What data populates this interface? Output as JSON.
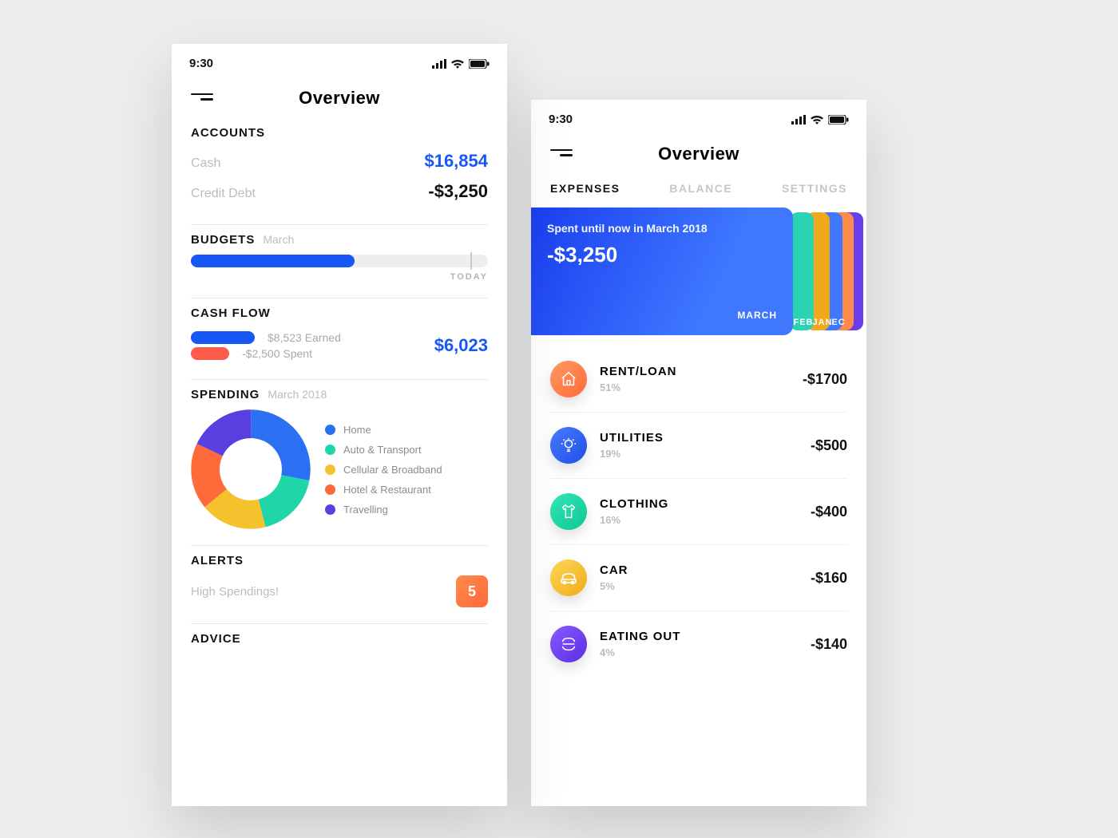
{
  "status": {
    "time": "9:30"
  },
  "header": {
    "title": "Overview"
  },
  "left": {
    "accounts": {
      "title": "ACCOUNTS",
      "rows": [
        {
          "label": "Cash",
          "value": "$16,854",
          "color": "blue"
        },
        {
          "label": "Credit Debt",
          "value": "-$3,250",
          "color": "dark"
        }
      ]
    },
    "budgets": {
      "title": "BUDGETS",
      "month": "March",
      "today_label": "TODAY",
      "fill_pct": 55,
      "today_pct": 94
    },
    "cashflow": {
      "title": "CASH FLOW",
      "earned": "$8,523 Earned",
      "spent": "-$2,500 Spent",
      "net": "$6,023"
    },
    "spending": {
      "title": "SPENDING",
      "month": "March 2018"
    },
    "alerts": {
      "title": "ALERTS",
      "text": "High Spendings!",
      "count": "5"
    },
    "advice": {
      "title": "ADVICE"
    }
  },
  "right": {
    "tabs": {
      "expenses": "EXPENSES",
      "balance": "BALANCE",
      "settings": "SETTINGS"
    },
    "card": {
      "subtitle": "Spent until now in March 2018",
      "amount": "-$3,250",
      "month_main": "MARCH",
      "months": {
        "feb": "FEB",
        "jan": "JAN",
        "dec": "EC"
      }
    },
    "expenses": [
      {
        "name": "RENT/LOAN",
        "pct": "51%",
        "amount": "-$1700",
        "color": "#ff7a4a",
        "icon": "home"
      },
      {
        "name": "UTILITIES",
        "pct": "19%",
        "amount": "-$500",
        "color": "#2f62f2",
        "icon": "bulb"
      },
      {
        "name": "CLOTHING",
        "pct": "16%",
        "amount": "-$400",
        "color": "#1ed6a8",
        "icon": "shirt"
      },
      {
        "name": "CAR",
        "pct": "5%",
        "amount": "-$160",
        "color": "#f4c62e",
        "icon": "car"
      },
      {
        "name": "EATING OUT",
        "pct": "4%",
        "amount": "-$140",
        "color": "#6a3eea",
        "icon": "food"
      }
    ]
  },
  "chart_data": {
    "type": "pie",
    "title": "Spending March 2018",
    "categories": [
      "Home",
      "Auto & Transport",
      "Cellular & Broadband",
      "Hotel & Restaurant",
      "Travelling"
    ],
    "values": [
      28,
      18,
      18,
      18,
      18
    ],
    "colors": [
      "#2b6ff2",
      "#1ed6a8",
      "#f3c22d",
      "#ff6a3a",
      "#5a3fe0"
    ]
  },
  "colors": {
    "accent_blue": "#1856f5",
    "accent_red": "#ff5b4a",
    "text_muted": "#b9bcc3"
  }
}
